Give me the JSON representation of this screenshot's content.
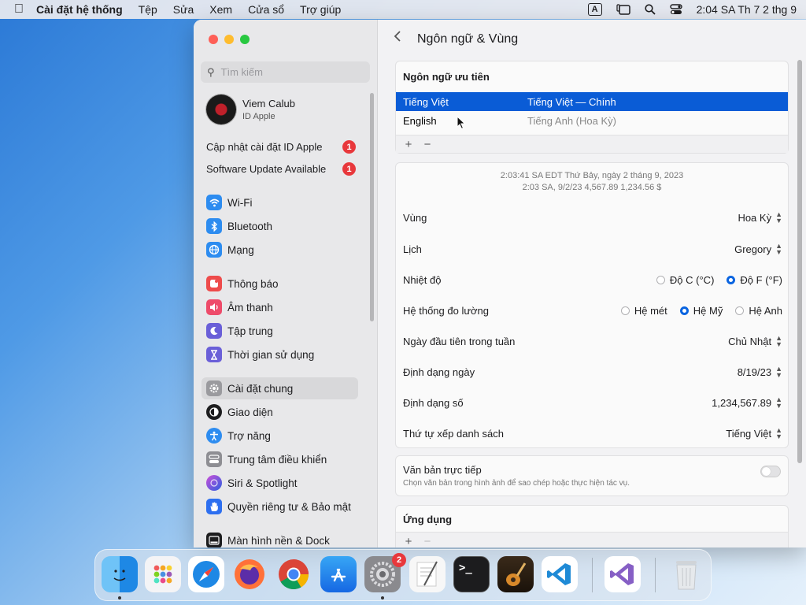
{
  "menubar": {
    "app": "Cài đặt hệ thống",
    "items": [
      "Tệp",
      "Sửa",
      "Xem",
      "Cửa sổ",
      "Trợ giúp"
    ],
    "input_badge": "A",
    "clock": "2:04 SA Th 7 2 thg 9"
  },
  "sidebar": {
    "search_placeholder": "Tìm kiếm",
    "profile": {
      "name": "Viem Calub",
      "sub": "ID Apple"
    },
    "notices": [
      {
        "label": "Cập nhật cài đặt ID Apple",
        "badge": "1"
      },
      {
        "label": "Software Update Available",
        "badge": "1"
      }
    ],
    "items": [
      {
        "label": "Wi-Fi",
        "icon": "wifi-icon",
        "color": "#2d8cf0"
      },
      {
        "label": "Bluetooth",
        "icon": "bluetooth-icon",
        "color": "#2d8cf0"
      },
      {
        "label": "Mạng",
        "icon": "globe-icon",
        "color": "#2d8cf0"
      },
      {
        "label": "Thông báo",
        "icon": "bell-icon",
        "color": "#ee4b4b"
      },
      {
        "label": "Âm thanh",
        "icon": "speaker-icon",
        "color": "#ee4b6a"
      },
      {
        "label": "Tập trung",
        "icon": "moon-icon",
        "color": "#6a5fd8"
      },
      {
        "label": "Thời gian sử dụng",
        "icon": "hourglass-icon",
        "color": "#6a5fd8"
      },
      {
        "label": "Cài đặt chung",
        "icon": "gear-icon",
        "color": "#9a9a9e"
      },
      {
        "label": "Giao diện",
        "icon": "appearance-icon",
        "color": "#1d1d1f"
      },
      {
        "label": "Trợ năng",
        "icon": "accessibility-icon",
        "color": "#2d8cf0"
      },
      {
        "label": "Trung tâm điều khiển",
        "icon": "control-center-icon",
        "color": "#8e8e93"
      },
      {
        "label": "Siri & Spotlight",
        "icon": "siri-icon",
        "color": "#b040d0"
      },
      {
        "label": "Quyền riêng tư & Bảo mật",
        "icon": "hand-icon",
        "color": "#2d6ff0"
      },
      {
        "label": "Màn hình nền & Dock",
        "icon": "dock-icon",
        "color": "#1d1d1f"
      }
    ]
  },
  "main": {
    "title": "Ngôn ngữ & Vùng",
    "preferred_header": "Ngôn ngữ ưu tiên",
    "languages": [
      {
        "name": "Tiếng Việt",
        "desc": "Tiếng Việt — Chính"
      },
      {
        "name": "English",
        "desc": "Tiếng Anh (Hoa Kỳ)"
      }
    ],
    "plus": "+",
    "minus": "−",
    "sample_line1": "2:03:41 SA EDT Thứ Bảy, ngày 2 tháng 9, 2023",
    "sample_line2": "2:03 SA, 9/2/23     4,567.89     1,234.56 $",
    "region_label": "Vùng",
    "region_value": "Hoa Kỳ",
    "calendar_label": "Lịch",
    "calendar_value": "Gregory",
    "temp_label": "Nhiệt độ",
    "temp_c": "Độ C (°C)",
    "temp_f": "Độ F (°F)",
    "measure_label": "Hệ thống đo lường",
    "measure_metric": "Hệ mét",
    "measure_us": "Hệ Mỹ",
    "measure_uk": "Hệ Anh",
    "firstday_label": "Ngày đầu tiên trong tuần",
    "firstday_value": "Chủ Nhật",
    "dateformat_label": "Định dạng ngày",
    "dateformat_value": "8/19/23",
    "numformat_label": "Định dạng số",
    "numformat_value": "1,234,567.89",
    "sort_label": "Thứ tự xếp danh sách",
    "sort_value": "Tiếng Việt",
    "livetext_title": "Văn bản trực tiếp",
    "livetext_sub": "Chọn văn bản trong hình ảnh để sao chép hoặc thực hiện tác vụ.",
    "apps_header": "Ứng dụng"
  },
  "dock": {
    "settings_badge": "2",
    "terminal_glyph": ">_"
  }
}
